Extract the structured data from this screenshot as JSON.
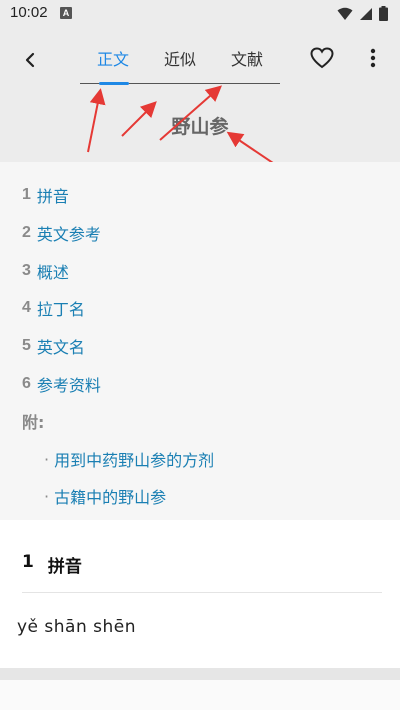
{
  "status_bar": {
    "time": "10:02",
    "notification_icon": "A"
  },
  "header": {
    "tabs": [
      {
        "label": "正文",
        "active": true
      },
      {
        "label": "近似",
        "active": false
      },
      {
        "label": "文献",
        "active": false
      }
    ],
    "title": "野山参"
  },
  "toc": {
    "items": [
      {
        "num": "1",
        "label": "拼音"
      },
      {
        "num": "2",
        "label": "英文参考"
      },
      {
        "num": "3",
        "label": "概述"
      },
      {
        "num": "4",
        "label": "拉丁名"
      },
      {
        "num": "5",
        "label": "英文名"
      },
      {
        "num": "6",
        "label": "参考资料"
      }
    ],
    "attachment_label": "附:",
    "sub_items": [
      {
        "dot": "·",
        "label": "用到中药野山参的方剂"
      },
      {
        "dot": "·",
        "label": "古籍中的野山参"
      }
    ]
  },
  "section": {
    "num": "1",
    "title": "拼音",
    "content": "yě shān shēn"
  },
  "colors": {
    "accent": "#1e88e5",
    "link": "#1a7fb3",
    "annotation_arrow": "#e53935"
  },
  "icons": [
    "back-arrow-icon",
    "heart-outline-icon",
    "more-vertical-icon",
    "wifi-icon",
    "signal-icon",
    "battery-icon"
  ]
}
